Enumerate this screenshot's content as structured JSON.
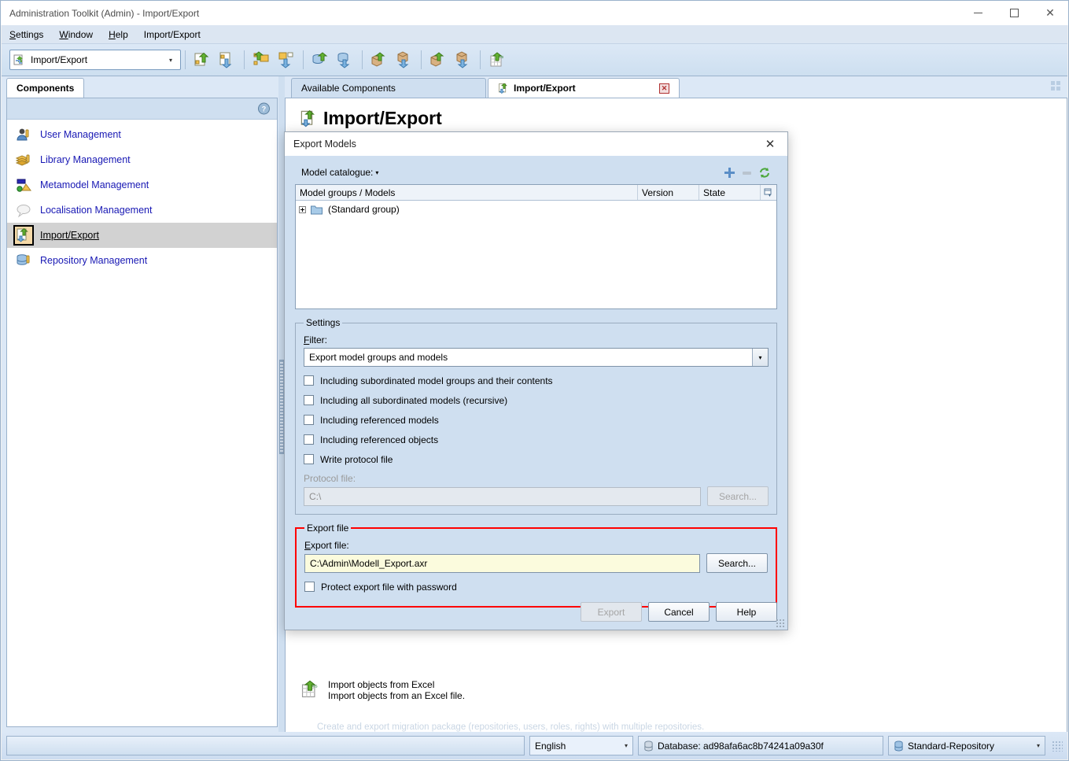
{
  "window": {
    "title": "Administration Toolkit (Admin) - Import/Export",
    "minimize_label": "─",
    "maximize_label": "□",
    "close_label": "✕"
  },
  "menubar": {
    "items": [
      {
        "label": "Settings"
      },
      {
        "label": "Window"
      },
      {
        "label": "Help"
      },
      {
        "label": "Import/Export"
      }
    ]
  },
  "toolbar": {
    "component_combo": {
      "value": "Import/Export",
      "arrow": "▾"
    },
    "buttons": [
      {
        "name": "import-model-button",
        "title": "Import model"
      },
      {
        "name": "export-model-button",
        "title": "Export model"
      },
      {
        "name": "import-model-group-button",
        "title": "Import model group"
      },
      {
        "name": "export-model-group-button",
        "title": "Export model group"
      },
      {
        "name": "import-database-button",
        "title": "Import database"
      },
      {
        "name": "export-database-button",
        "title": "Export database"
      },
      {
        "name": "import-package-button",
        "title": "Import package"
      },
      {
        "name": "export-package-button",
        "title": "Export package"
      },
      {
        "name": "import-migration-package-button",
        "title": "Import migration package"
      },
      {
        "name": "export-migration-package-button",
        "title": "Export migration package"
      },
      {
        "name": "import-excel-button",
        "title": "Import objects from Excel"
      }
    ]
  },
  "sidebar": {
    "tab_label": "Components",
    "help_icon": "help-icon",
    "items": [
      {
        "label": "User Management",
        "icon": "user-management-icon",
        "selected": false
      },
      {
        "label": "Library Management",
        "icon": "library-management-icon",
        "selected": false
      },
      {
        "label": "Metamodel Management",
        "icon": "metamodel-management-icon",
        "selected": false
      },
      {
        "label": "Localisation Management",
        "icon": "localisation-management-icon",
        "selected": false
      },
      {
        "label": "Import/Export",
        "icon": "import-export-icon",
        "selected": true
      },
      {
        "label": "Repository Management",
        "icon": "repository-management-icon",
        "selected": false
      }
    ]
  },
  "main": {
    "tabs": [
      {
        "label": "Available Components",
        "active": false,
        "closable": false
      },
      {
        "label": "Import/Export",
        "active": true,
        "closable": true
      }
    ],
    "page_title": "Import/Export",
    "obscured_line": "Create and export migration package (repositories, users, roles, rights) with multiple repositories.",
    "excel_entry": {
      "link": "Import objects from Excel",
      "description": "Import objects from an Excel file."
    },
    "grid_icon": "grid-view-icon"
  },
  "dialog": {
    "title": "Export Models",
    "close_label": "✕",
    "catalogue": {
      "label": "Model catalogue:",
      "caret": "▾",
      "add_label": "+",
      "remove_label": "─",
      "refresh_label": "refresh-icon"
    },
    "tree": {
      "columns": [
        "Model groups / Models",
        "Version",
        "State"
      ],
      "column_chooser_icon": "column-chooser-icon",
      "rows": [
        {
          "name": "(Standard group)",
          "version": "",
          "state": "",
          "icon": "folder-icon",
          "expandable": true
        }
      ]
    },
    "settings": {
      "legend": "Settings",
      "filter_label": "Filter:",
      "filter_value": "Export model groups and models",
      "filter_arrow": "▾",
      "checkboxes": [
        {
          "label": "Including subordinated model groups and their contents",
          "checked": false,
          "mnemonic_index": 1
        },
        {
          "label": "Including all subordinated models (recursive)",
          "checked": false,
          "mnemonic_index": 2
        },
        {
          "label": "Including referenced models",
          "checked": false,
          "mnemonic_index": 22
        },
        {
          "label": "Including referenced objects",
          "checked": false,
          "mnemonic_index": 24
        },
        {
          "label": "Write protocol file",
          "checked": false,
          "mnemonic_index": 0
        }
      ],
      "protocol_label": "Protocol file:",
      "protocol_value": "C:\\",
      "protocol_search_label": "Search...",
      "protocol_disabled": true
    },
    "export_file": {
      "legend": "Export file",
      "label": "Export file:",
      "value": "C:\\Admin\\Modell_Export.axr",
      "search_label": "Search...",
      "protect_checkbox": {
        "label": "Protect export file with password",
        "checked": false
      },
      "highlight_color": "#ff0000"
    },
    "buttons": [
      {
        "label": "Export",
        "disabled": true,
        "name": "export-button"
      },
      {
        "label": "Cancel",
        "disabled": false,
        "name": "cancel-button"
      },
      {
        "label": "Help",
        "disabled": false,
        "name": "help-button"
      }
    ]
  },
  "statusbar": {
    "message": "",
    "language": {
      "value": "English",
      "arrow": "▾"
    },
    "database": {
      "label": "Database: ad98afa6ac8b74241a09a30f",
      "icon": "database-icon"
    },
    "repository": {
      "value": "Standard-Repository",
      "icon": "database-icon",
      "arrow": "▾"
    }
  },
  "colors": {
    "accent": "#1818b4",
    "panel": "#cfdff0",
    "toolbar": "#dce8f6",
    "highlight_box": "#ff0000",
    "field_highlight": "#fbfbdd"
  }
}
